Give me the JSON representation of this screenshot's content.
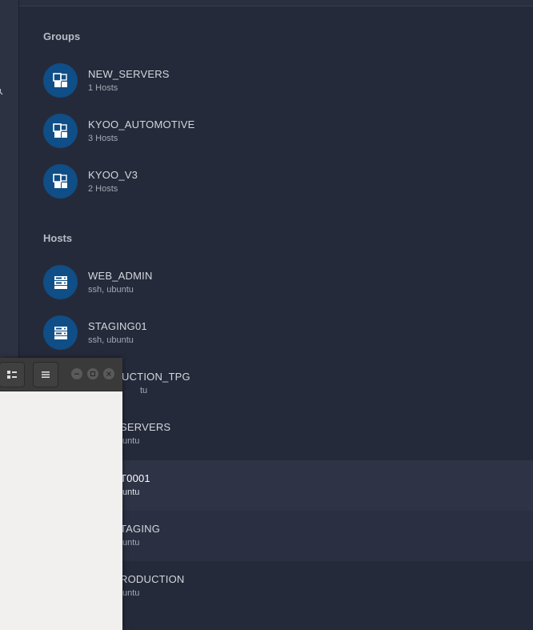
{
  "groups_section": {
    "title": "Groups",
    "items": [
      {
        "name": "NEW_SERVERS",
        "detail": "1 Hosts"
      },
      {
        "name": "KYOO_AUTOMOTIVE",
        "detail": "3 Hosts"
      },
      {
        "name": "KYOO_V3",
        "detail": "2 Hosts"
      }
    ]
  },
  "hosts_section": {
    "title": "Hosts",
    "items": [
      {
        "name": "WEB_ADMIN",
        "detail": "ssh, ubuntu"
      },
      {
        "name": "STAGING01",
        "detail": "ssh, ubuntu"
      },
      {
        "name": "UCTION_TPG",
        "detail": "tu"
      },
      {
        "name": "SERVERS",
        "detail": "untu"
      },
      {
        "name": "T0001",
        "detail": "untu"
      },
      {
        "name": "TAGING",
        "detail": "untu"
      },
      {
        "name": "RODUCTION",
        "detail": "untu"
      }
    ]
  },
  "icons": {
    "group": "group-icon",
    "host": "server-icon",
    "search": "search-icon"
  },
  "colors": {
    "background": "#252a3a",
    "avatar": "#0f4e86",
    "selected_row": "#2e3345"
  }
}
